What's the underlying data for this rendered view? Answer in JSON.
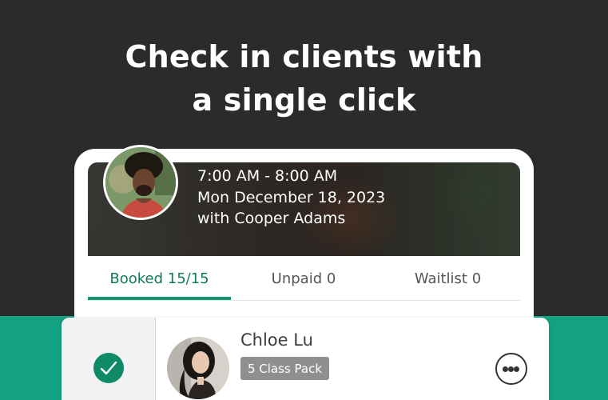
{
  "headline": {
    "line1": "Check in clients with",
    "line2": "a single click"
  },
  "class_info": {
    "time": "7:00 AM - 8:00 AM",
    "date": "Mon December 18, 2023",
    "instructor": "with Cooper Adams"
  },
  "tabs": [
    {
      "label": "Booked 15/15",
      "active": true
    },
    {
      "label": "Unpaid 0",
      "active": false
    },
    {
      "label": "Waitlist 0",
      "active": false
    }
  ],
  "client": {
    "name": "Chloe Lu",
    "pack": "5 Class Pack",
    "checked_in": true
  },
  "colors": {
    "background": "#2b2b2b",
    "brand_green": "#13a281",
    "accent": "#0e8a67",
    "badge": "#8f8f8f"
  },
  "icons": {
    "check": "check-circle-icon",
    "more": "more-options-icon"
  }
}
